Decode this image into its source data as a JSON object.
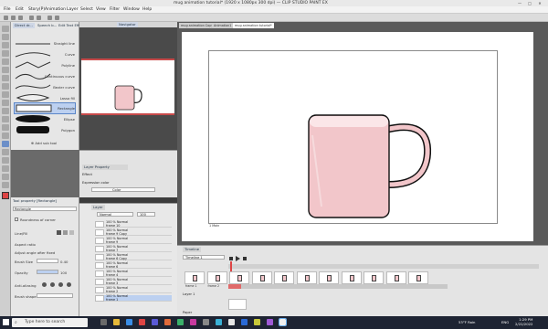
{
  "window": {
    "title": "mug animation tutorial* (1920 x 1080px 300 dpi)    — CLIP STUDIO PAINT EX",
    "minimize": "—",
    "maximize": "□",
    "close": "✕"
  },
  "menu": [
    "File",
    "Edit",
    "Story(P)",
    "Animation",
    "Layer",
    "Select",
    "View",
    "Filter",
    "Window",
    "Help"
  ],
  "subtool": {
    "tabs": [
      "Direct dr...",
      "Speech b...",
      "Edit Text Effects"
    ],
    "shapes": [
      {
        "label": "Straight line"
      },
      {
        "label": "Curve"
      },
      {
        "label": "Polyline"
      },
      {
        "label": "Continuous curve"
      },
      {
        "label": "Bezier curve"
      },
      {
        "label": "Lasso fill"
      },
      {
        "label": "Rectangle",
        "selected": true
      },
      {
        "label": "Ellipse"
      },
      {
        "label": "Polygon"
      }
    ],
    "add_label": "Add sub tool"
  },
  "toolprop": {
    "header": "Tool property [Rectangle]",
    "tool_name": "Rectangle",
    "roundness": "Roundness of corner",
    "line_fill": "Line/Fill",
    "aspect": "Aspect ratio",
    "adjust": "Adjust angle after fixed",
    "brush_size_label": "Brush Size",
    "brush_size_value": "0.40",
    "opacity_label": "Opacity",
    "opacity_value": "100",
    "anti_aliasing": "Anti-aliasing",
    "brush_shape": "Brush shape"
  },
  "navigator": {
    "tab": "Navigator"
  },
  "layer_property": {
    "tab": "Layer Property",
    "effect": "Effect",
    "expression_color": "Expression color",
    "color_value": "Color"
  },
  "layer_panel": {
    "tab": "Layer",
    "blend_mode": "Normal",
    "opacity": "100",
    "rows": [
      {
        "name": "100 % Normal\nframe 10"
      },
      {
        "name": "100 % Normal\nframe 9 Copy"
      },
      {
        "name": "100 % Normal\nframe 9"
      },
      {
        "name": "100 % Normal\nframe 7"
      },
      {
        "name": "100 % Normal\nframe 6 Copy"
      },
      {
        "name": "100 % Normal\nframe 6"
      },
      {
        "name": "100 % Normal\nframe 4"
      },
      {
        "name": "100 % Normal\nframe 3"
      },
      {
        "name": "100 % Normal\nframe 2"
      },
      {
        "name": "100 % Normal\nframe 1"
      }
    ]
  },
  "canvas": {
    "tabs": [
      "mug animation Copy",
      "Animation1",
      "mug animation tutorial*"
    ],
    "frame_label": "1 Main"
  },
  "timeline": {
    "tab": "Timeline",
    "timeline_name": "Timeline 1",
    "cels": [
      "frame 1",
      "frame 2",
      "frame 3",
      "frame 4",
      "frame 5",
      "frame 6",
      "frame 6 Copy",
      "frame 7",
      "frame 9",
      "frame 9 Copy",
      "frame 10"
    ],
    "layer_label": "Layer 1",
    "paper_label": "Paper"
  },
  "taskbar": {
    "search_placeholder": "Type here to search",
    "weather": "53°F  Rain",
    "time": "1:29 PM",
    "date": "2/22/2022",
    "lang": "ENG"
  },
  "colors": {
    "mug_fill": "#f2c6ca",
    "mug_rim": "#fbe6e8",
    "accent": "#c84a4a"
  }
}
